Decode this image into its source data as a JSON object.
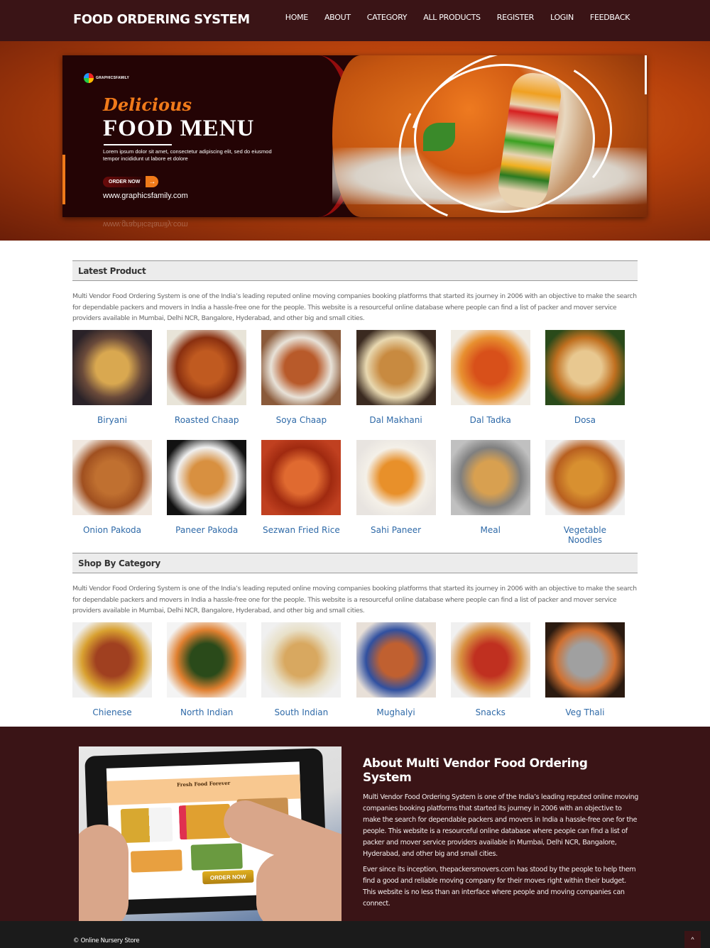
{
  "header": {
    "brand": "FOOD ORDERING SYSTEM",
    "nav": [
      "HOME",
      "ABOUT",
      "CATEGORY",
      "ALL PRODUCTS",
      "REGISTER",
      "LOGIN",
      "FEEDBACK"
    ]
  },
  "hero": {
    "logo_text": "GRAPHICSFAMILY",
    "script_title": "Delicious",
    "title": "FOOD MENU",
    "lorem": "Lorem ipsum dolor sit amet, consectetur adipiscing elit, sed do eiusmod tempor incididunt ut labore et dolore",
    "order_label": "ORDER NOW",
    "order_arrow": "→",
    "url": "www.graphicsfamily.com"
  },
  "latest": {
    "title": "Latest Product",
    "description": "Multi Vendor Food Ordering System is one of the India’s leading reputed online moving companies booking platforms that started its journey in 2006 with an objective to make the search for dependable packers and movers in India a hassle-free one for the people. This website is a resourceful online database where people can find a list of packer and mover service providers available in Mumbai, Delhi NCR, Bangalore, Hyderabad, and other big and small cities.",
    "products": [
      {
        "name": "Biryani",
        "colors": [
          "#2a2228",
          "#d9a850",
          "#6a4a3a"
        ]
      },
      {
        "name": "Roasted Chaap",
        "colors": [
          "#e8e4d8",
          "#c05a20",
          "#8a3010"
        ]
      },
      {
        "name": "Soya Chaap",
        "colors": [
          "#8a5a3a",
          "#b85a2a",
          "#e8e2d8"
        ]
      },
      {
        "name": "Dal Makhani",
        "colors": [
          "#3a2a20",
          "#c88a40",
          "#e8d8b0"
        ]
      },
      {
        "name": "Dal Tadka",
        "colors": [
          "#f0ece4",
          "#d8501a",
          "#e89030"
        ]
      },
      {
        "name": "Dosa",
        "colors": [
          "#2a4a1a",
          "#e8c890",
          "#c07020"
        ]
      },
      {
        "name": "Onion Pakoda",
        "colors": [
          "#f0e8e0",
          "#c07030",
          "#a05020"
        ]
      },
      {
        "name": "Paneer Pakoda",
        "colors": [
          "#111111",
          "#d89040",
          "#f0f0f0"
        ]
      },
      {
        "name": "Sezwan Fried Rice",
        "colors": [
          "#c04020",
          "#e06a30",
          "#a02a10"
        ]
      },
      {
        "name": "Sahi Paneer",
        "colors": [
          "#e8e4e0",
          "#e8902a",
          "#f4f0e8"
        ]
      },
      {
        "name": "Meal",
        "colors": [
          "#c0c0c0",
          "#d8a050",
          "#808080"
        ]
      },
      {
        "name": "Vegetable Noodles",
        "colors": [
          "#f0f0f0",
          "#d89030",
          "#b86020"
        ]
      }
    ]
  },
  "category": {
    "title": "Shop By Category",
    "description": "Multi Vendor Food Ordering System is one of the India’s leading reputed online moving companies booking platforms that started its journey in 2006 with an objective to make the search for dependable packers and movers in India a hassle-free one for the people. This website is a resourceful online database where people can find a list of packer and mover service providers available in Mumbai, Delhi NCR, Bangalore, Hyderabad, and other big and small cities.",
    "items": [
      {
        "name": "Chienese",
        "colors": [
          "#f0f0f0",
          "#a04020",
          "#d8a030"
        ]
      },
      {
        "name": "North Indian",
        "colors": [
          "#f4f4f4",
          "#2a4a1a",
          "#e08030"
        ]
      },
      {
        "name": "South Indian",
        "colors": [
          "#f0f0f0",
          "#d8a860",
          "#e8e0c8"
        ]
      },
      {
        "name": "Mughalyi",
        "colors": [
          "#e8e0d8",
          "#c06030",
          "#3050a0"
        ]
      },
      {
        "name": "Snacks",
        "colors": [
          "#f0f0f0",
          "#c03020",
          "#d89040"
        ]
      },
      {
        "name": "Veg Thali",
        "colors": [
          "#2a1a10",
          "#a0a0a0",
          "#d07030"
        ]
      }
    ]
  },
  "about": {
    "title": "About Multi Vendor Food Ordering System",
    "p1": "Multi Vendor Food Ordering System is one of the India’s leading reputed online moving companies booking platforms that started its journey in 2006 with an objective to make the search for dependable packers and movers in India a hassle-free one for the people. This website is a resourceful online database where people can find a list of packer and mover service providers available in Mumbai, Delhi NCR, Bangalore, Hyderabad, and other big and small cities.",
    "p2": "Ever since its inception, thepackersmovers.com has stood by the people to help them find a good and reliable moving company for their moves right within their budget. This website is no less than an interface where people and moving companies can connect.",
    "tablet_screen_title": "Fresh Food Forever",
    "tablet_order_label": "ORDER NOW"
  },
  "footer": {
    "copyright": "© Online Nursery Store",
    "scroll_top_icon": "^"
  }
}
